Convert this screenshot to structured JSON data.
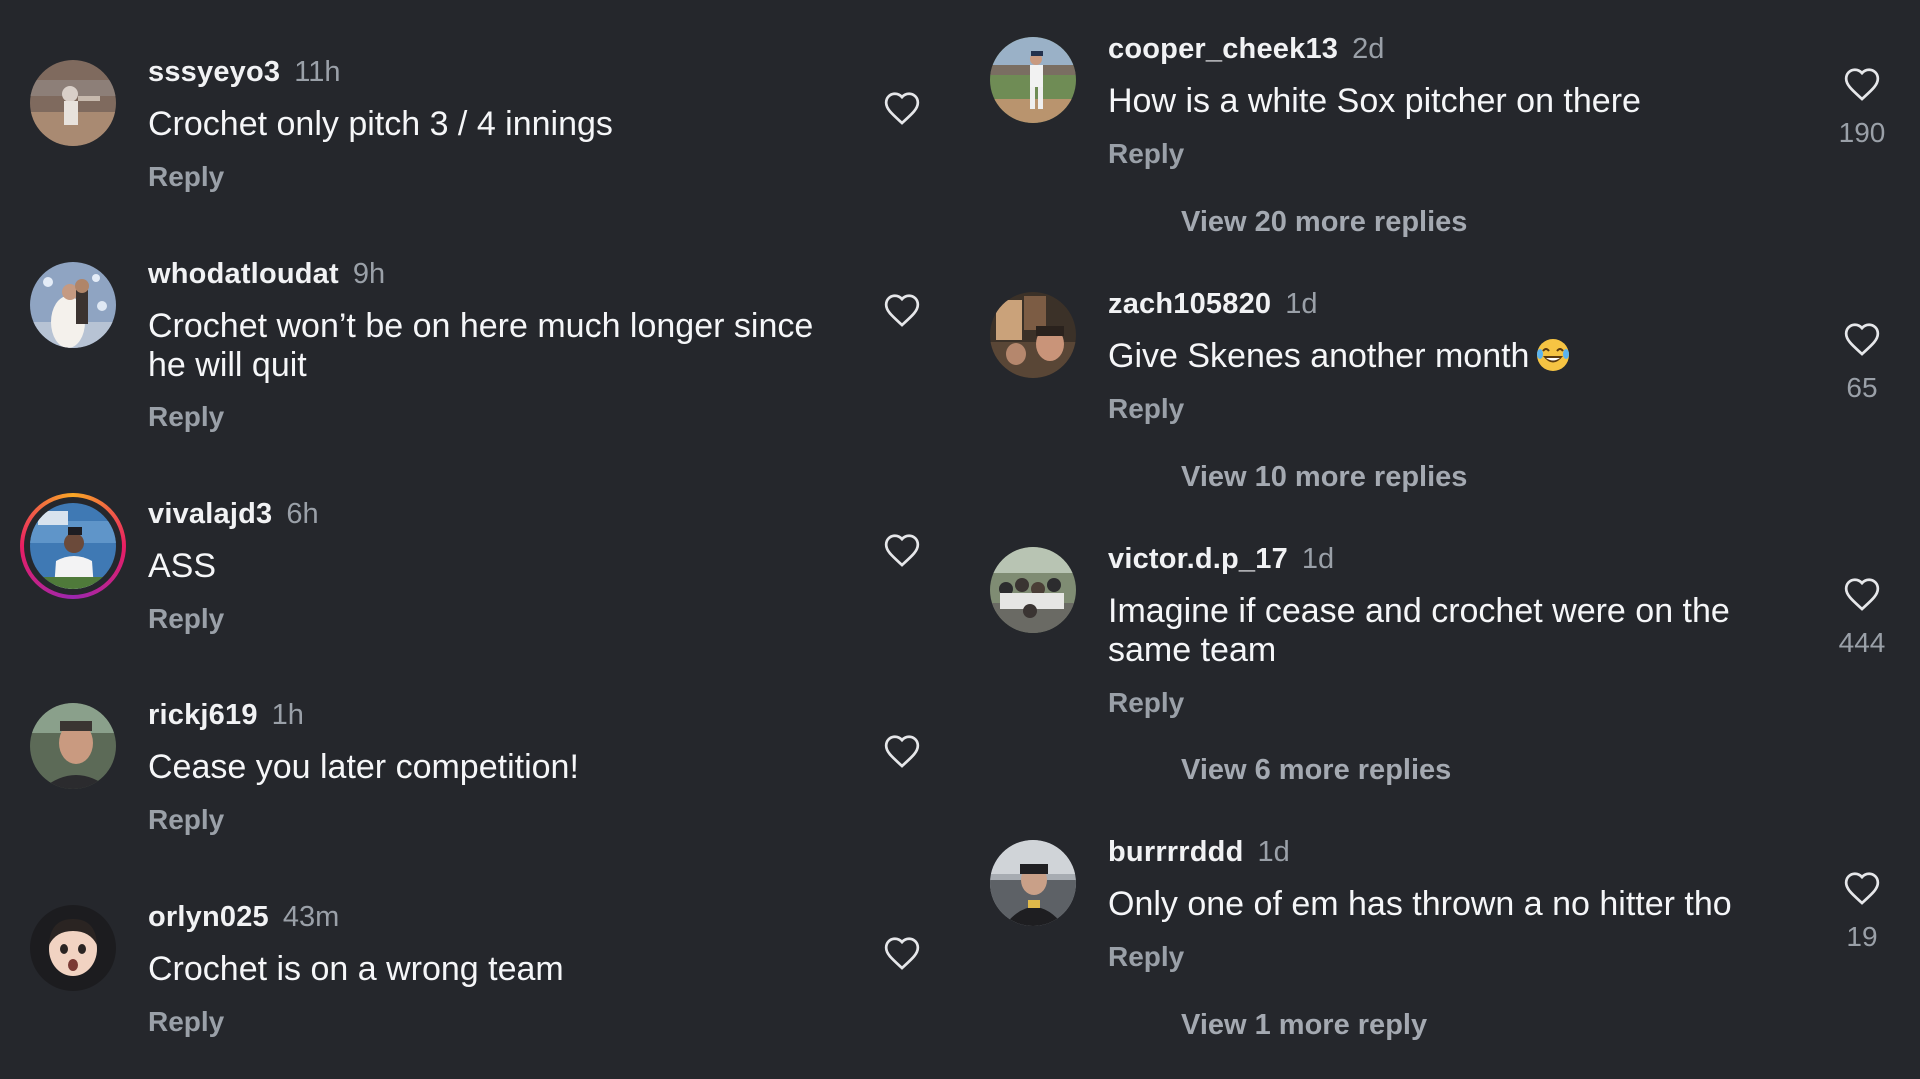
{
  "reply_label": "Reply",
  "left_column": [
    {
      "username": "sssyeyo3",
      "time": "11h",
      "text_lines": [
        "Crochet only pitch 3 / 4 innings"
      ]
    },
    {
      "username": "whodatloudat",
      "time": "9h",
      "text_lines": [
        "Crochet won’t be on here much longer since",
        "he will quit"
      ]
    },
    {
      "username": "vivalajd3",
      "time": "6h",
      "text_lines": [
        "ASS"
      ]
    },
    {
      "username": "rickj619",
      "time": "1h",
      "text_lines": [
        "Cease you later competition!"
      ]
    },
    {
      "username": "orlyn025",
      "time": "43m",
      "text_lines": [
        "Crochet is on a wrong team"
      ]
    }
  ],
  "right_column": [
    {
      "username": "cooper_cheek13",
      "time": "2d",
      "text_lines": [
        "How is a white Sox pitcher on there"
      ],
      "likes": "190",
      "view_more": "View 20 more replies"
    },
    {
      "username": "zach105820",
      "time": "1d",
      "text_lines": [
        "Give Skenes another month"
      ],
      "emoji": "laughing-tears",
      "likes": "65",
      "view_more": "View 10 more replies"
    },
    {
      "username": "victor.d.p_17",
      "time": "1d",
      "text_lines": [
        "Imagine if cease and crochet were on the",
        "same team"
      ],
      "likes": "444",
      "view_more": "View 6 more replies"
    },
    {
      "username": "burrrrddd",
      "time": "1d",
      "text_lines": [
        "Only one of em has thrown a no hitter tho"
      ],
      "likes": "19",
      "view_more": "View 1 more reply"
    }
  ],
  "colors": {
    "background": "#25272c",
    "primary_text": "#f5f6f8",
    "secondary_text": "#9aa0a8"
  },
  "icons": {
    "like": "heart-outline-icon",
    "story_ring": "story-ring"
  }
}
